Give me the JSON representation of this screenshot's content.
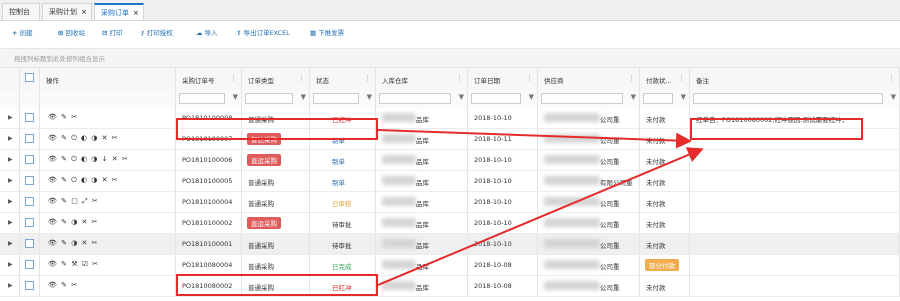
{
  "tabs": [
    {
      "label": "控制台",
      "closable": false,
      "active": false
    },
    {
      "label": "采购计划",
      "closable": true,
      "active": false
    },
    {
      "label": "采购订单",
      "closable": true,
      "active": true
    }
  ],
  "toolbar": [
    {
      "icon": "plus-icon",
      "glyph": "+",
      "label": "创建"
    },
    {
      "icon": "recycle-bin-icon",
      "glyph": "⊞",
      "label": "回收站"
    },
    {
      "icon": "printer-icon",
      "glyph": "⊟",
      "label": "打印"
    },
    {
      "icon": "key-icon",
      "glyph": "⚷",
      "label": "打印授权"
    },
    {
      "icon": "cloud-upload-icon",
      "glyph": "☁",
      "label": "导入"
    },
    {
      "icon": "export-icon",
      "glyph": "⇪",
      "label": "导出订单EXCEL"
    },
    {
      "icon": "document-icon",
      "glyph": "▦",
      "label": "下推发票"
    }
  ],
  "group_hint": "拖拽列标题到此处按列组合显示",
  "columns": [
    "操作",
    "采购订单号",
    "订单类型",
    "状态",
    "入库仓库",
    "订单日期",
    "供应商",
    "付款状...",
    "备注"
  ],
  "rows": [
    {
      "ops": "👁 ✎ ✂",
      "order": "PO1810100008",
      "type": "普通采购",
      "type_tag": "",
      "status": "已红冲",
      "status_class": "st-red",
      "warehouse": "品库",
      "date": "2018-10-10",
      "supplier": "公司重",
      "pay": "未付款",
      "pay_tag": "",
      "remark": "红单自：PO1810080002,红冲原因:测试需要红冲，"
    },
    {
      "ops": "👁 ✎ ⏻ ◐ ◑ ✕ ✂",
      "order": "PO1810100007",
      "type": "",
      "type_tag": "智达采购",
      "status": "制单",
      "status_class": "st-blue",
      "warehouse": "品库",
      "date": "2018-10-11",
      "supplier": "公司重",
      "pay": "未付款",
      "pay_tag": "",
      "remark": ""
    },
    {
      "ops": "👁 ✎ ⏻ ◐ ◑ ↓ ✕ ✂",
      "order": "PO1810100006",
      "type": "",
      "type_tag": "直运采购",
      "status": "制单",
      "status_class": "st-blue",
      "warehouse": "品库",
      "date": "2018-10-10",
      "supplier": "公司重",
      "pay": "未付款",
      "pay_tag": "",
      "remark": ""
    },
    {
      "ops": "👁 ✎ ⏻ ◐ ◑ ✕ ✂",
      "order": "PO1810100005",
      "type": "普通采购",
      "type_tag": "",
      "status": "制单",
      "status_class": "st-blue",
      "warehouse": "品库",
      "date": "2018-10-10",
      "supplier": "有限公司重",
      "pay": "未付款",
      "pay_tag": "",
      "remark": ""
    },
    {
      "ops": "👁 ✎ ▢ ⤢ ✂",
      "order": "PO1810100004",
      "type": "普通采购",
      "type_tag": "",
      "status": "已审核",
      "status_class": "st-orange",
      "warehouse": "品库",
      "date": "2018-10-10",
      "supplier": "公司重",
      "pay": "未付款",
      "pay_tag": "",
      "remark": ""
    },
    {
      "ops": "👁 ✎ ◑ ✕ ✂",
      "order": "PO1810100002",
      "type": "",
      "type_tag": "直运采购",
      "status": "待审批",
      "status_class": "st-dark",
      "warehouse": "品库",
      "date": "2018-10-10",
      "supplier": "公司重",
      "pay": "未付款",
      "pay_tag": "",
      "remark": ""
    },
    {
      "ops": "👁 ✎ ◑ ✕ ✂",
      "order": "PO1810100001",
      "type": "普通采购",
      "type_tag": "",
      "status": "待审批",
      "status_class": "st-dark",
      "warehouse": "品库",
      "date": "2018-10-10",
      "supplier": "公司重",
      "pay": "未付款",
      "pay_tag": "",
      "remark": ""
    },
    {
      "ops": "👁 ✎ ⚒ ☑ ✂",
      "order": "PO1810080004",
      "type": "普通采购",
      "type_tag": "",
      "status": "已完成",
      "status_class": "st-green",
      "warehouse": "品库",
      "date": "2018-10-08",
      "supplier": "公司重",
      "pay": "",
      "pay_tag": "部分付款",
      "remark": ""
    },
    {
      "ops": "👁 ✎ ✂",
      "order": "PO1810080002",
      "type": "普通采购",
      "type_tag": "",
      "status": "已红冲",
      "status_class": "st-red",
      "warehouse": "品库",
      "date": "2018-10-08",
      "supplier": "公司重",
      "pay": "未付款",
      "pay_tag": "",
      "remark": ""
    }
  ]
}
